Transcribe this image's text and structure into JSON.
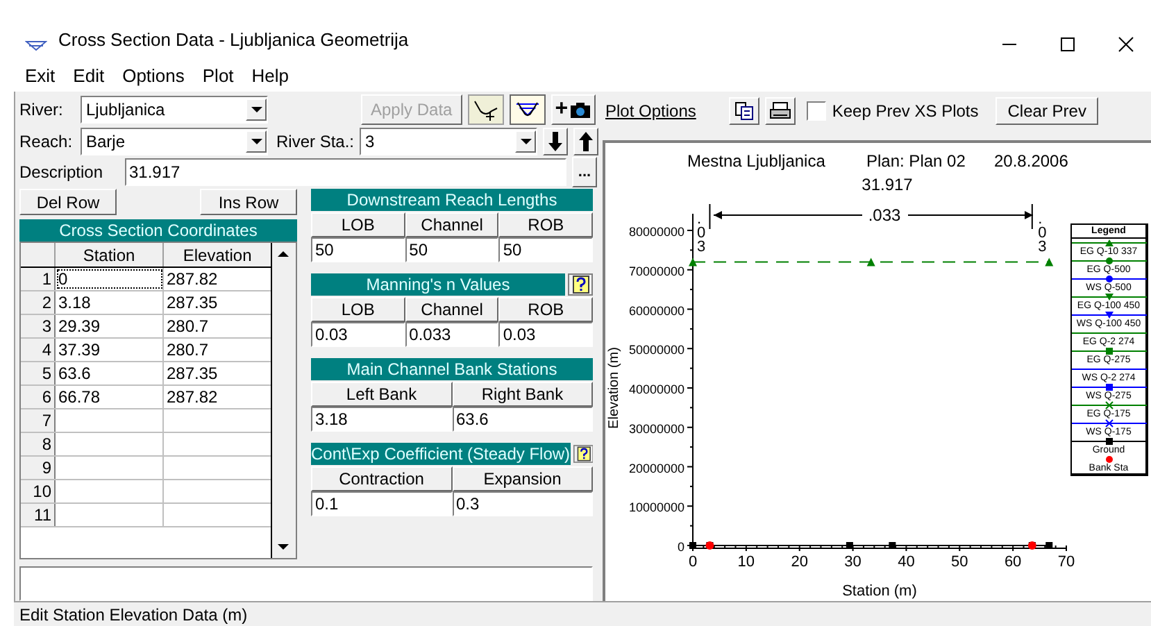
{
  "window": {
    "title": "Cross Section Data - Ljubljanica Geometrija"
  },
  "menu": [
    "Exit",
    "Edit",
    "Options",
    "Plot",
    "Help"
  ],
  "river": {
    "label": "River:",
    "value": "Ljubljanica"
  },
  "apply_button": {
    "label": "Apply Data",
    "disabled": true
  },
  "plot_mode_buttons": [
    {
      "selected": false
    },
    {
      "selected": true
    }
  ],
  "add_button": {
    "label": "+"
  },
  "reach": {
    "label": "Reach:",
    "value": "Barje"
  },
  "river_station": {
    "label": "River Sta.:",
    "value": "3"
  },
  "description": {
    "label": "Description",
    "value": "31.917",
    "button": "..."
  },
  "row_buttons": [
    "Del Row",
    "Ins Row"
  ],
  "coordinates": {
    "title": "Cross Section Coordinates",
    "columns": [
      "Station",
      "Elevation"
    ],
    "rows": [
      {
        "number": "1",
        "station": "0",
        "elevation": "287.82",
        "focused": true
      },
      {
        "number": "2",
        "station": "3.18",
        "elevation": "287.35",
        "focused": false
      },
      {
        "number": "3",
        "station": "29.39",
        "elevation": "280.7",
        "focused": false
      },
      {
        "number": "4",
        "station": "37.39",
        "elevation": "280.7",
        "focused": false
      },
      {
        "number": "5",
        "station": "63.6",
        "elevation": "287.35",
        "focused": false
      },
      {
        "number": "6",
        "station": "66.78",
        "elevation": "287.82",
        "focused": false
      },
      {
        "number": "7",
        "focused": false
      },
      {
        "number": "8",
        "focused": false
      },
      {
        "number": "9",
        "focused": false
      },
      {
        "number": "10",
        "focused": false
      },
      {
        "number": "11",
        "focused": false
      }
    ]
  },
  "panels": [
    {
      "title": "Downstream Reach Lengths",
      "help": false,
      "columns": [
        "LOB",
        "Channel",
        "ROB"
      ],
      "values": [
        "50",
        "50",
        "50"
      ]
    },
    {
      "title": "Manning's n Values",
      "help": true,
      "columns": [
        "LOB",
        "Channel",
        "ROB"
      ],
      "values": [
        "0.03",
        "0.033",
        "0.03"
      ]
    },
    {
      "title": "Main Channel Bank Stations",
      "help": false,
      "columns": [
        "Left Bank",
        "Right Bank"
      ],
      "values": [
        "3.18",
        "63.6"
      ]
    },
    {
      "title": "Cont\\Exp Coefficient (Steady Flow)",
      "help": true,
      "columns": [
        "Contraction",
        "Expansion"
      ],
      "values": [
        "0.1",
        "0.3"
      ]
    }
  ],
  "status_bar": "Edit Station Elevation Data (m)",
  "plot_toolbar": {
    "link": "Plot Options",
    "keep_prev": {
      "label": "Keep Prev XS Plots",
      "checked": false
    },
    "clear_button": "Clear Prev"
  },
  "plot": {
    "header": [
      "Mestna Ljubljanica",
      "Plan: Plan 02",
      "20.8.2006"
    ],
    "subtitle": "31.917",
    "n_value": ".033",
    "bank_labels": [
      ".03",
      ".03"
    ],
    "legend_title": "Legend",
    "legend": [
      {
        "label": "EG Q-10 337",
        "color": "#008000",
        "kind": "triangle"
      },
      {
        "label": "EG Q-500",
        "color": "#008000",
        "kind": "circle"
      },
      {
        "label": "WS Q-500",
        "color": "#0000ff",
        "kind": "circle"
      },
      {
        "label": "EG Q-100  450",
        "color": "#008000",
        "kind": "triangledown"
      },
      {
        "label": "WS Q-100  450",
        "color": "#0000ff",
        "kind": "triangledown"
      },
      {
        "label": "EG Q-2 274",
        "color": "#008000",
        "kind": "line"
      },
      {
        "label": "EG Q-275",
        "color": "#008000",
        "kind": "square"
      },
      {
        "label": "WS Q-2 274",
        "color": "#0000ff",
        "kind": "line"
      },
      {
        "label": "WS Q-275",
        "color": "#0000ff",
        "kind": "square"
      },
      {
        "label": "EG Q-175",
        "color": "#008000",
        "kind": "cross"
      },
      {
        "label": "WS Q-175",
        "color": "#0000ff",
        "kind": "cross"
      },
      {
        "label": "Ground",
        "color": "#000000",
        "kind": "square"
      },
      {
        "label": "Bank Sta",
        "color": "#ff0000",
        "kind": "dot"
      }
    ],
    "chart_data": {
      "type": "line",
      "xlabel": "Station (m)",
      "ylabel": "Elevation (m)",
      "x": [
        0,
        3.18,
        29.39,
        33.4,
        37.39,
        63.6,
        66.78
      ],
      "series": [
        {
          "color": "#008000",
          "line_style": "dashed",
          "marker": "triangle",
          "values": [
            72000000,
            null,
            null,
            72000000,
            null,
            null,
            72000000
          ]
        },
        {
          "color": "#000000",
          "line_style": "solid",
          "marker": "square",
          "values": [
            0,
            0,
            0,
            null,
            0,
            0,
            0
          ]
        },
        {
          "color": "#ff0000",
          "line_style": "none",
          "marker": "circle",
          "values": [
            null,
            0,
            null,
            null,
            null,
            0,
            null
          ]
        }
      ],
      "xlim": [
        0,
        70
      ],
      "ylim": [
        0,
        80000000
      ],
      "xticks": [
        0,
        10,
        20,
        30,
        40,
        50,
        60,
        70
      ],
      "yticks": [
        0,
        10000000,
        20000000,
        30000000,
        40000000,
        50000000,
        60000000,
        70000000,
        80000000
      ]
    }
  }
}
